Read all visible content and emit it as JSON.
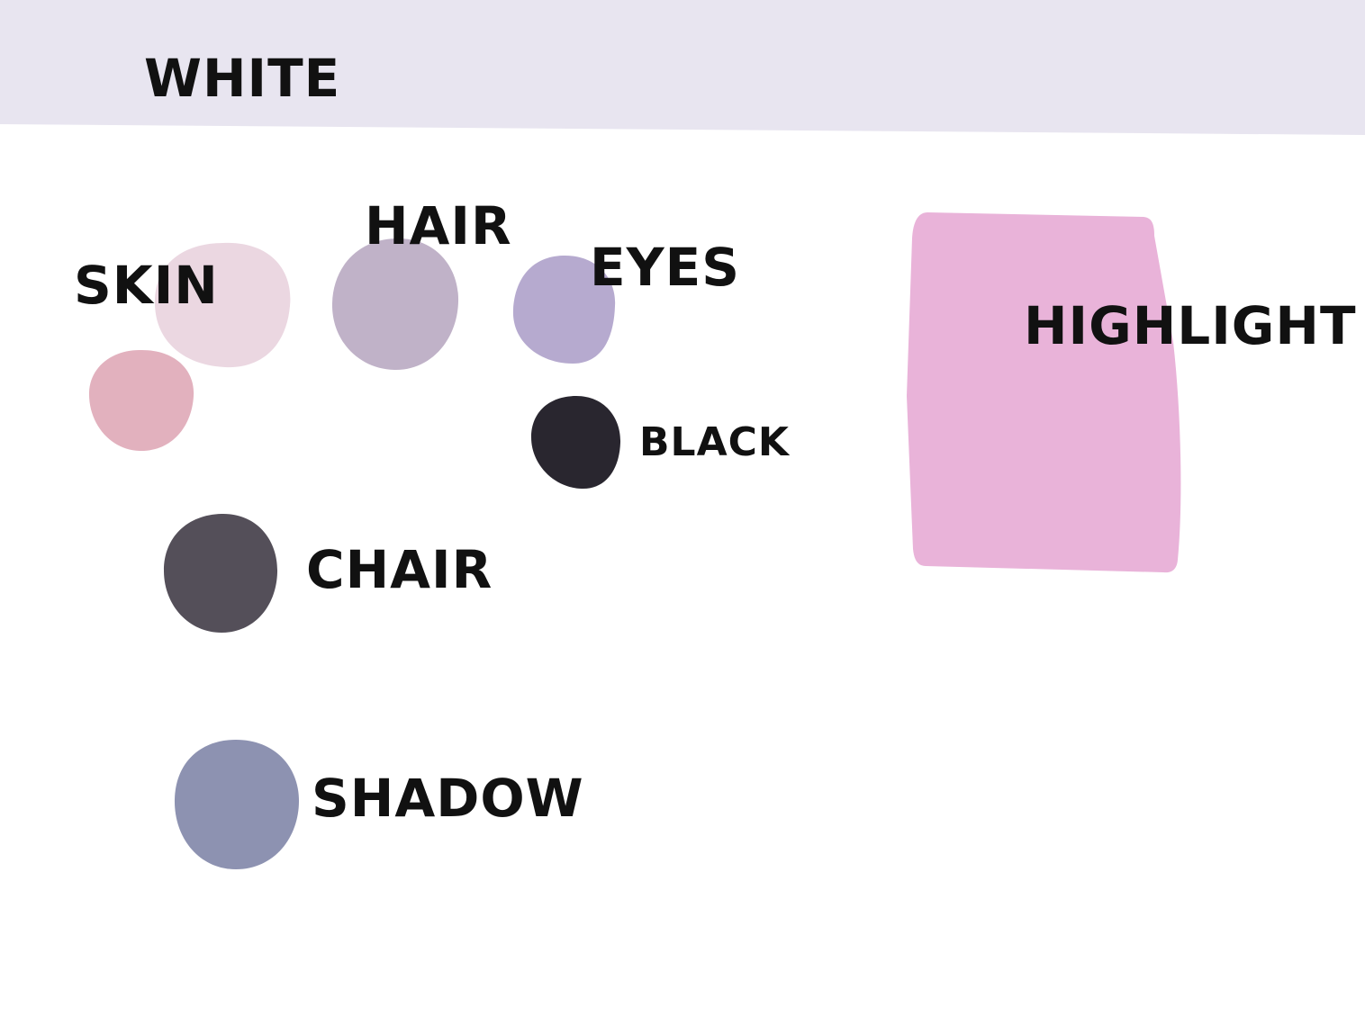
{
  "swatches": {
    "white": {
      "label": "WHITE",
      "color": "#e8e5f0"
    },
    "skin": {
      "label": "SKIN",
      "colors": [
        "#ebd7e1",
        "#e2b1be"
      ]
    },
    "hair": {
      "label": "HAIR",
      "color": "#c0b2c8"
    },
    "eyes": {
      "label": "EYES",
      "color": "#b6aacf"
    },
    "black": {
      "label": "BLACK",
      "color": "#29262f"
    },
    "chair": {
      "label": "CHAIR",
      "color": "#544f59"
    },
    "shadow": {
      "label": "SHADOW",
      "color": "#8d92b1"
    },
    "highlight": {
      "label": "HIGHLIGHT",
      "color": "#e9b3d9"
    }
  }
}
